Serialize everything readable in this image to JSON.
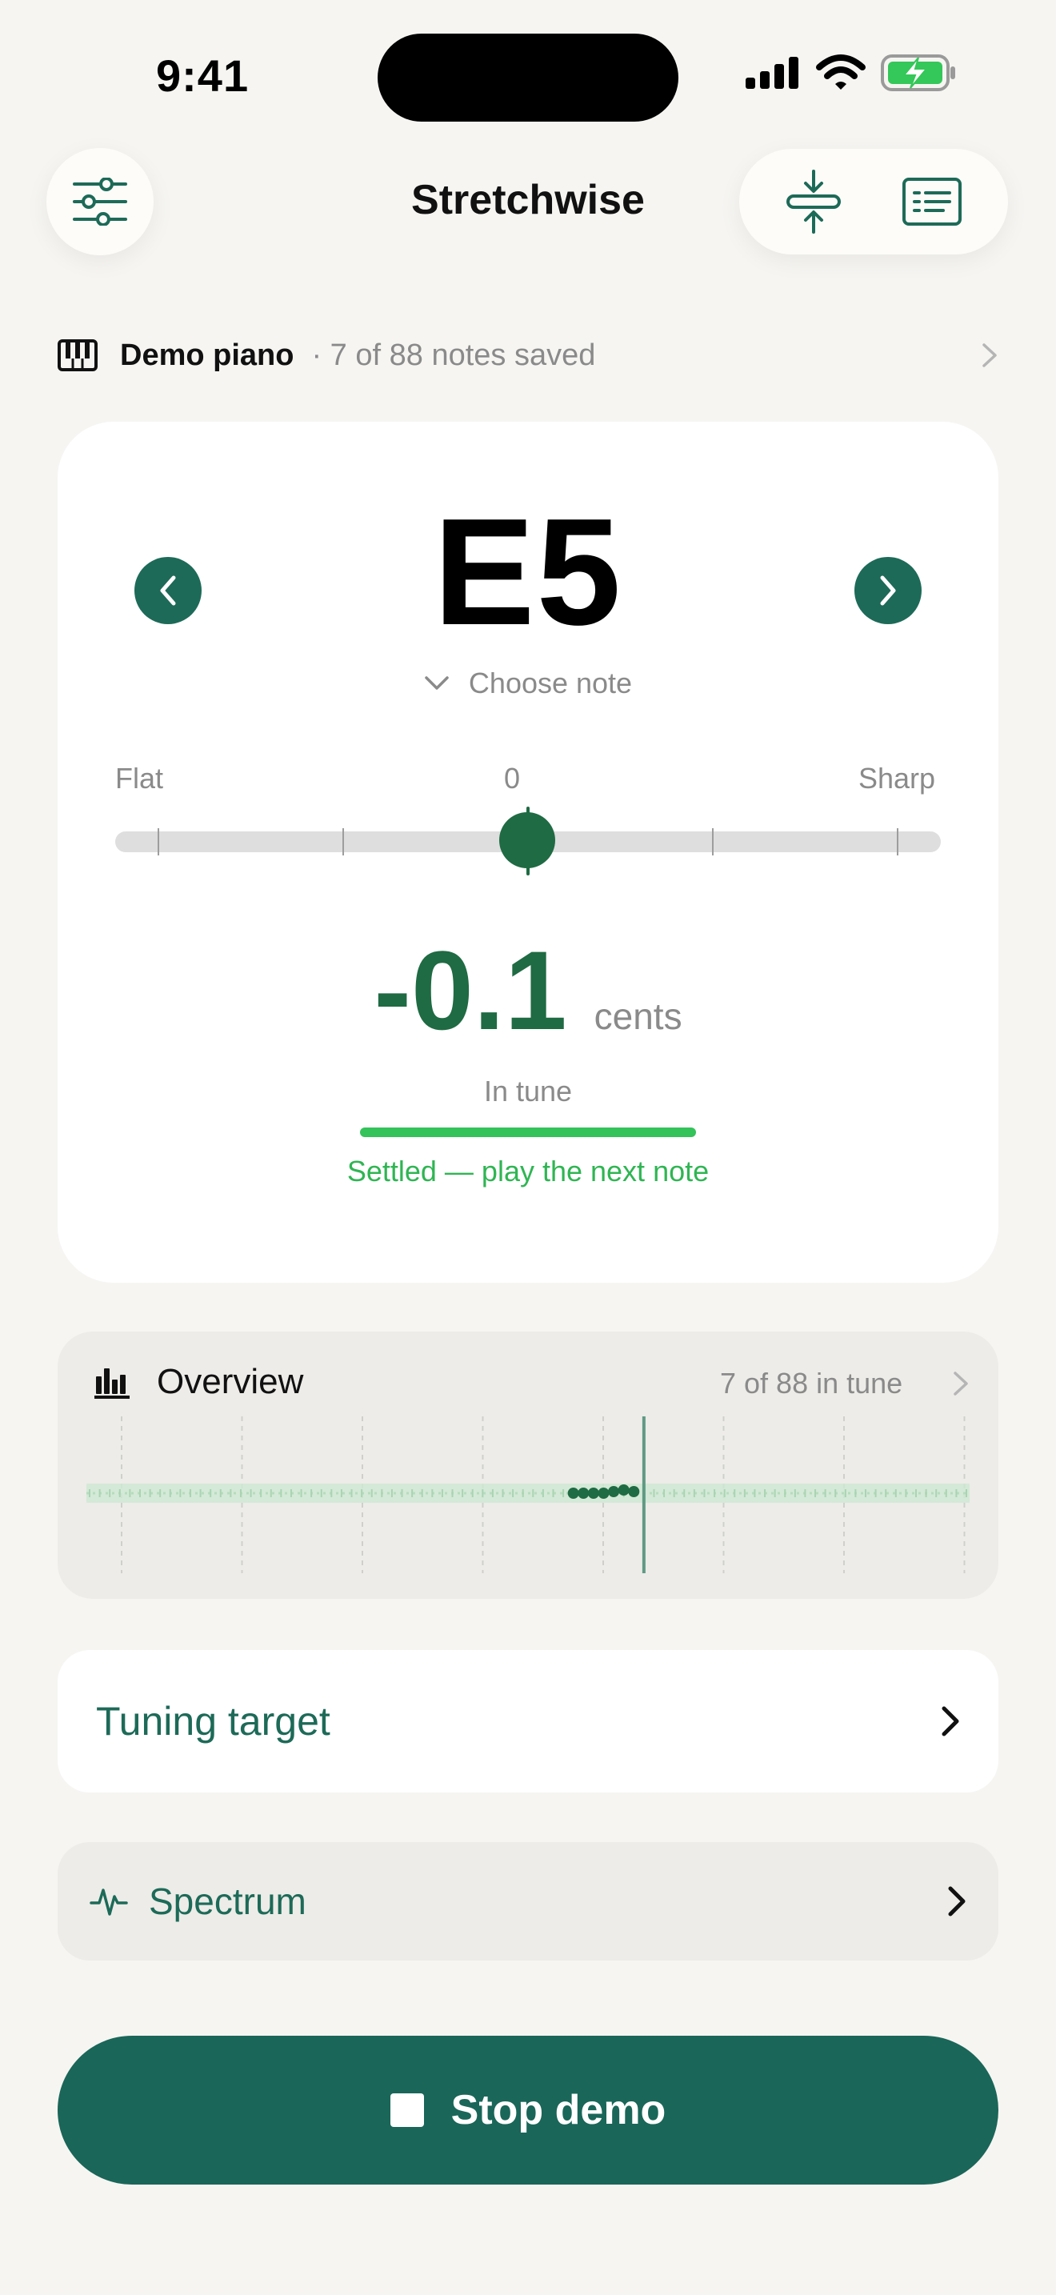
{
  "status_bar": {
    "time": "9:41"
  },
  "header": {
    "title": "Stretchwise"
  },
  "piano": {
    "name": "Demo piano",
    "saved": "· 7 of 88 notes saved"
  },
  "tuner": {
    "note": "E5",
    "choose_label": "Choose note",
    "flat_label": "Flat",
    "center_label": "0",
    "sharp_label": "Sharp",
    "offset_cents": -0.1,
    "cents_value": "-0.1",
    "cents_unit": "cents",
    "status": "In tune",
    "hint": "Settled — play the next note"
  },
  "overview": {
    "title": "Overview",
    "count": "7 of 88 in tune",
    "total_notes": 88,
    "current_index": 55,
    "tuned_offsets": [
      0,
      0,
      0,
      0,
      1,
      2,
      1
    ]
  },
  "tuning_target": {
    "label": "Tuning target"
  },
  "spectrum": {
    "label": "Spectrum"
  },
  "demo": {
    "stop_label": "Stop demo"
  },
  "colors": {
    "accent": "#1d6a58",
    "in_tune": "#1f6b43",
    "settled": "#2fb553",
    "battery": "#34c759"
  },
  "icons": {
    "settings": "sliders-icon",
    "compress": "compress-vertical-icon",
    "list": "list-panel-icon",
    "piano": "piano-keys-icon",
    "overview": "bar-chart-icon",
    "spectrum": "waveform-icon"
  }
}
